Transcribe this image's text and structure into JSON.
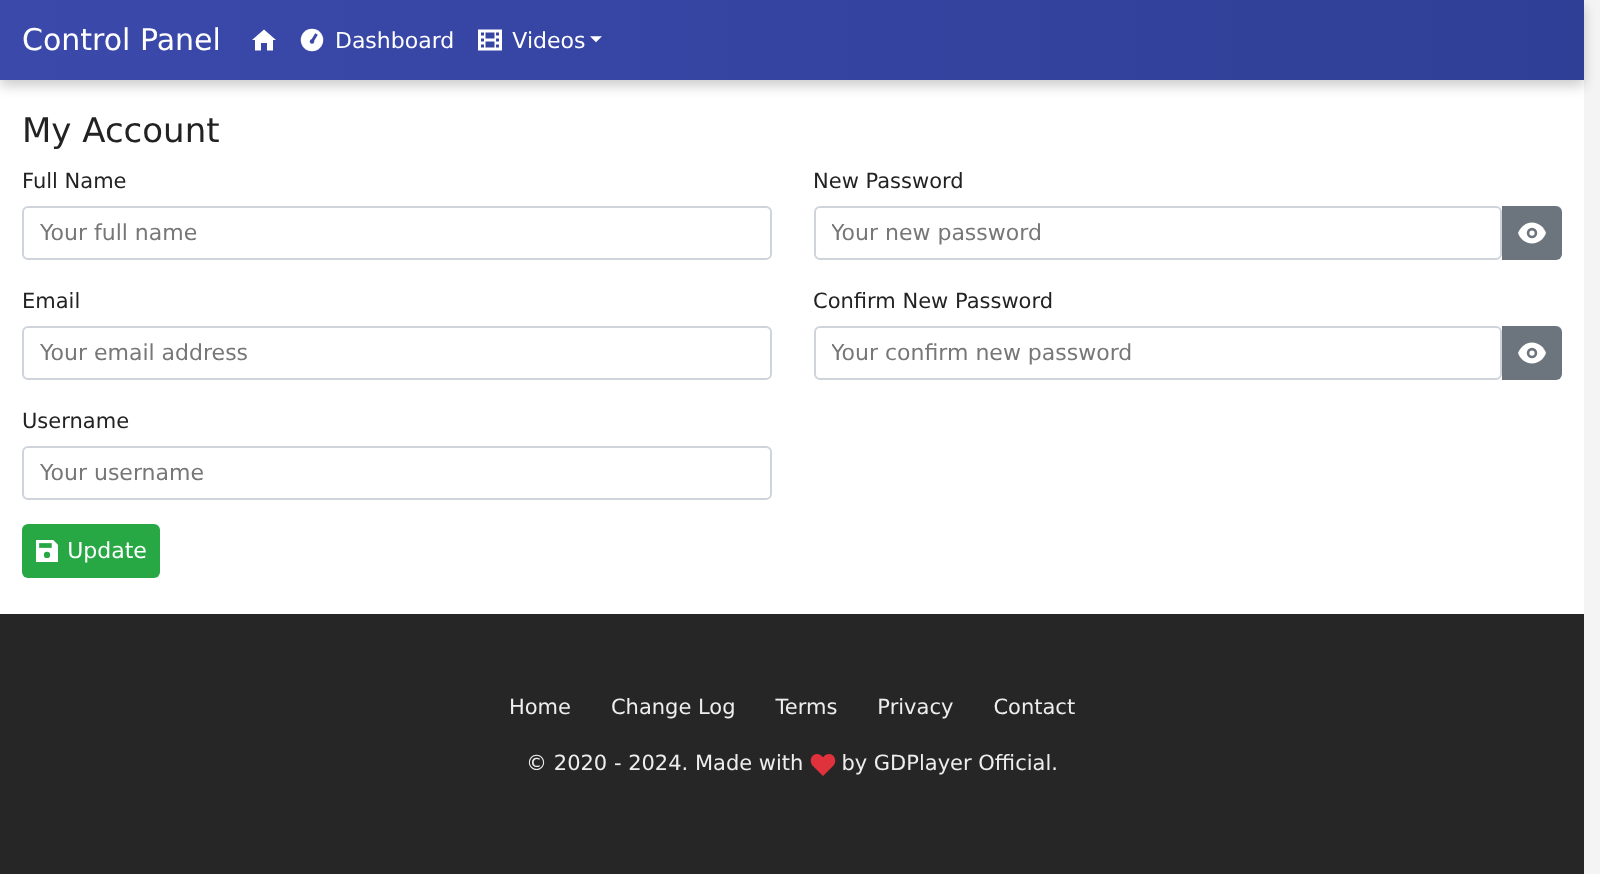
{
  "navbar": {
    "brand": "Control Panel",
    "items": [
      {
        "kind": "home"
      },
      {
        "kind": "dashboard",
        "label": "Dashboard"
      },
      {
        "kind": "videos",
        "label": "Videos",
        "dropdown": true
      }
    ]
  },
  "title": "My Account",
  "columns": [
    [
      {
        "label": "Full Name",
        "placeholder": "Your full name",
        "reveal": false
      },
      {
        "label": "Email",
        "placeholder": "Your email address",
        "reveal": false
      },
      {
        "label": "Username",
        "placeholder": "Your username",
        "reveal": false
      }
    ],
    [
      {
        "label": "New Password",
        "placeholder": "Your new password",
        "reveal": true
      },
      {
        "label": "Confirm New Password",
        "placeholder": "Your confirm new password",
        "reveal": true
      }
    ]
  ],
  "submit": "Update",
  "footer": {
    "links": [
      "Home",
      "Change Log",
      "Terms",
      "Privacy",
      "Contact"
    ],
    "credit_before": "© 2020 - 2024. Made with",
    "credit_after": "by GDPlayer Official."
  }
}
